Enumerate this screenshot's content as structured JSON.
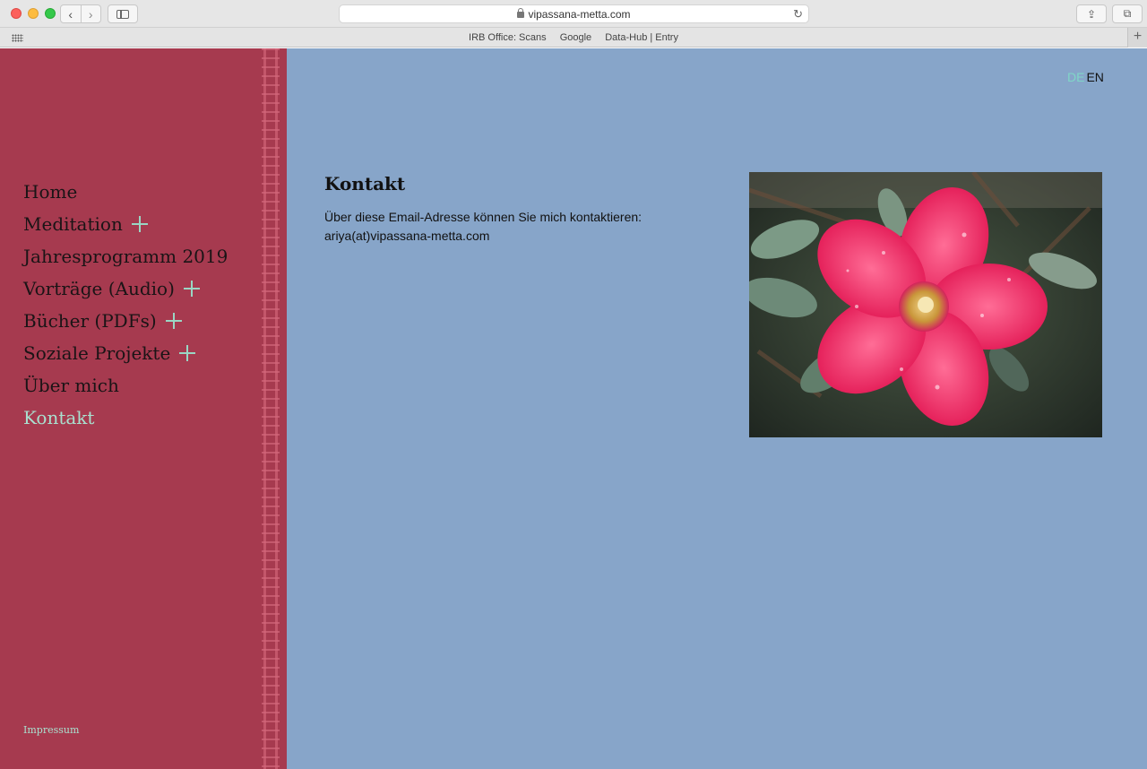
{
  "browser": {
    "url": "vipassana-metta.com",
    "bookmarks": [
      "IRB Office: Scans",
      "Google",
      "Data-Hub | Entry"
    ]
  },
  "sidebar": {
    "items": [
      {
        "label": "Home",
        "expandable": false,
        "active": false
      },
      {
        "label": "Meditation",
        "expandable": true,
        "active": false
      },
      {
        "label": "Jahresprogramm 2019",
        "expandable": false,
        "active": false
      },
      {
        "label": "Vorträge (Audio)",
        "expandable": true,
        "active": false
      },
      {
        "label": "Bücher (PDFs)",
        "expandable": true,
        "active": false
      },
      {
        "label": "Soziale Projekte",
        "expandable": true,
        "active": false
      },
      {
        "label": "Über mich",
        "expandable": false,
        "active": false
      },
      {
        "label": "Kontakt",
        "expandable": false,
        "active": true
      }
    ],
    "footer_link": "Impressum"
  },
  "language": {
    "de": "DE",
    "en": "EN",
    "selected": "DE"
  },
  "main": {
    "title": "Kontakt",
    "line1": "Über diese Email-Adresse können Sie mich kontaktieren:",
    "line2": "ariya(at)vipassana-metta.com",
    "image_icon": "pink-flower-photo"
  },
  "colors": {
    "sidebar_bg": "#a63a4f",
    "page_bg": "#87a5c9",
    "accent": "#a9e0cf"
  }
}
